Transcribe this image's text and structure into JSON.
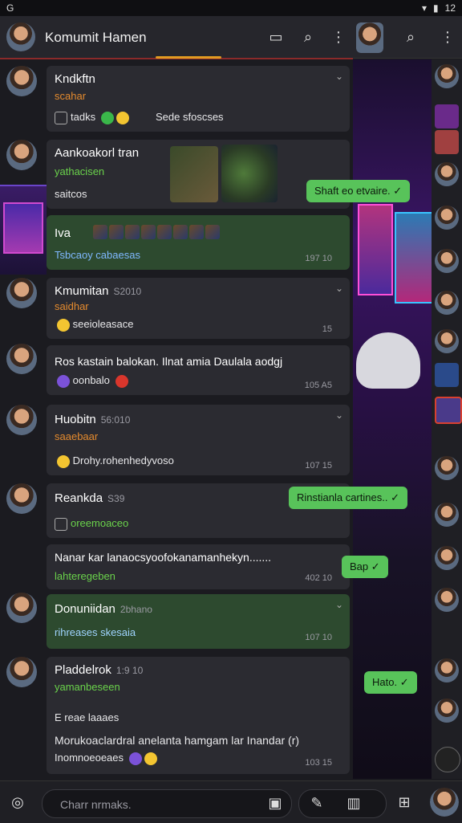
{
  "status_bar": {
    "left_icon": "G",
    "time": "12"
  },
  "header": {
    "title": "Komumit Hamen"
  },
  "messages": [
    {
      "name": "Kndkftn",
      "sub": "scahar",
      "line": "tadks",
      "line2": "Sede sfoscses"
    },
    {
      "name": "Aankoakorl tran",
      "sub": "yathacisen",
      "line": "saitcos"
    },
    {
      "name": "Iva",
      "line": "Tsbcaoy cabaesas",
      "time": "197 10"
    },
    {
      "name": "Kmumitan",
      "meta": "S2010",
      "sub": "saidhar",
      "line": "seeioleasace",
      "time": "15"
    },
    {
      "name": "Ros kastain balokan. Ilnat amia Daulala aodgj",
      "line": "oonbalo",
      "time": "105 A5"
    },
    {
      "name": "Huobitn",
      "meta": "56:010",
      "sub": "saaebaar",
      "line": "Drohy.rohenhedyvoso",
      "time": "107 15"
    },
    {
      "name": "Reankda",
      "meta": "S39",
      "line": "oreemoaceo"
    },
    {
      "name": "Nanar kar lanaocsyoofokanamanhekyn.......",
      "sub": "lahteregeben",
      "time": "402 10"
    },
    {
      "name": "Donuniidan",
      "meta": "2bhano",
      "line": "rihreases skesaia",
      "time": "107 10"
    },
    {
      "name": "Pladdelrok",
      "meta": "1:9 10",
      "sub": "yamanbeseen",
      "line": "E reae laaaes",
      "line2": "Morukoaclardral anelanta hamgam lar Inandar (r)",
      "line3": "Inomnoeoeaes",
      "time": "103 15"
    }
  ],
  "bubbles": [
    {
      "text": "Shaft eo etvaire."
    },
    {
      "text": "Rinstianla cartines.."
    },
    {
      "text": "Bap"
    },
    {
      "text": "Hato."
    }
  ],
  "compose": {
    "placeholder": "Charr nrmaks."
  },
  "colors": {
    "accent": "#e19a22",
    "bubble": "#58c35a",
    "card": "#2b2b31",
    "card_green": "#2d4a2f"
  }
}
